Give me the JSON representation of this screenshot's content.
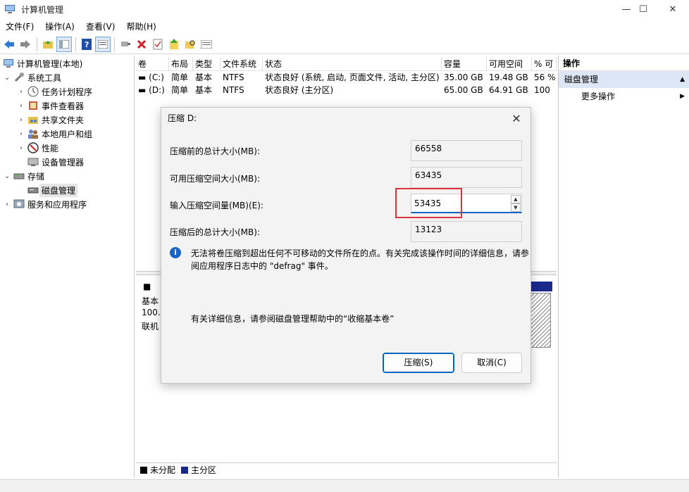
{
  "window": {
    "title": "计算机管理",
    "controls": {
      "minimize": "—",
      "maximize": "☐",
      "close": "✕"
    }
  },
  "menu": [
    "文件(F)",
    "操作(A)",
    "查看(V)",
    "帮助(H)"
  ],
  "toolbar": {
    "icons": [
      "back-arrow-icon",
      "forward-arrow-icon",
      "folder-up-icon",
      "console-tree-icon",
      "help-icon",
      "properties-icon",
      "connect-icon",
      "delete-icon",
      "check-icon",
      "up-arrow-icon",
      "search-folder-icon",
      "list-icon"
    ]
  },
  "tree": {
    "root": "计算机管理(本地)",
    "items": [
      {
        "label": "系统工具",
        "level": 1,
        "expander": "⌄"
      },
      {
        "label": "任务计划程序",
        "level": 2,
        "expander": "›"
      },
      {
        "label": "事件查看器",
        "level": 2,
        "expander": "›"
      },
      {
        "label": "共享文件夹",
        "level": 2,
        "expander": "›"
      },
      {
        "label": "本地用户和组",
        "level": 2,
        "expander": "›"
      },
      {
        "label": "性能",
        "level": 2,
        "expander": "›"
      },
      {
        "label": "设备管理器",
        "level": 2,
        "expander": ""
      },
      {
        "label": "存储",
        "level": 1,
        "expander": "⌄"
      },
      {
        "label": "磁盘管理",
        "level": 2,
        "expander": ""
      },
      {
        "label": "服务和应用程序",
        "level": 1,
        "expander": "›"
      }
    ]
  },
  "volumes": {
    "columns": [
      "卷",
      "布局",
      "类型",
      "文件系统",
      "状态",
      "容量",
      "可用空间",
      "% 可"
    ],
    "rows": [
      [
        "(C:)",
        "简单",
        "基本",
        "NTFS",
        "状态良好 (系统, 启动, 页面文件, 活动, 主分区)",
        "35.00 GB",
        "19.48 GB",
        "56 %"
      ],
      [
        "(D:)",
        "简单",
        "基本",
        "NTFS",
        "状态良好 (主分区)",
        "65.00 GB",
        "64.91 GB",
        "100"
      ]
    ]
  },
  "disk": {
    "type_short": "基本",
    "size_short": "100.(",
    "status_short": "联机",
    "name_short": "■"
  },
  "legend": [
    {
      "label": "未分配",
      "color": "#000000"
    },
    {
      "label": "主分区",
      "color": "#1a2a8c"
    }
  ],
  "actions": {
    "header": "操作",
    "section": "磁盘管理",
    "item": "更多操作"
  },
  "dialog": {
    "title": "压缩 D:",
    "fields": [
      {
        "label": "压缩前的总计大小(MB):",
        "value": "66558"
      },
      {
        "label": "可用压缩空间大小(MB):",
        "value": "63435"
      },
      {
        "label": "输入压缩空间量(MB)(E):",
        "value": "53435"
      },
      {
        "label": "压缩后的总计大小(MB):",
        "value": "13123"
      }
    ],
    "info_text": "无法将卷压缩到超出任何不可移动的文件所在的点。有关完成该操作时间的详细信息，请参阅应用程序日志中的 \"defrag\" 事件。",
    "more_text": "有关详细信息，请参阅磁盘管理帮助中的“收缩基本卷”",
    "shrink_button": "压缩(S)",
    "cancel_button": "取消(C)"
  }
}
